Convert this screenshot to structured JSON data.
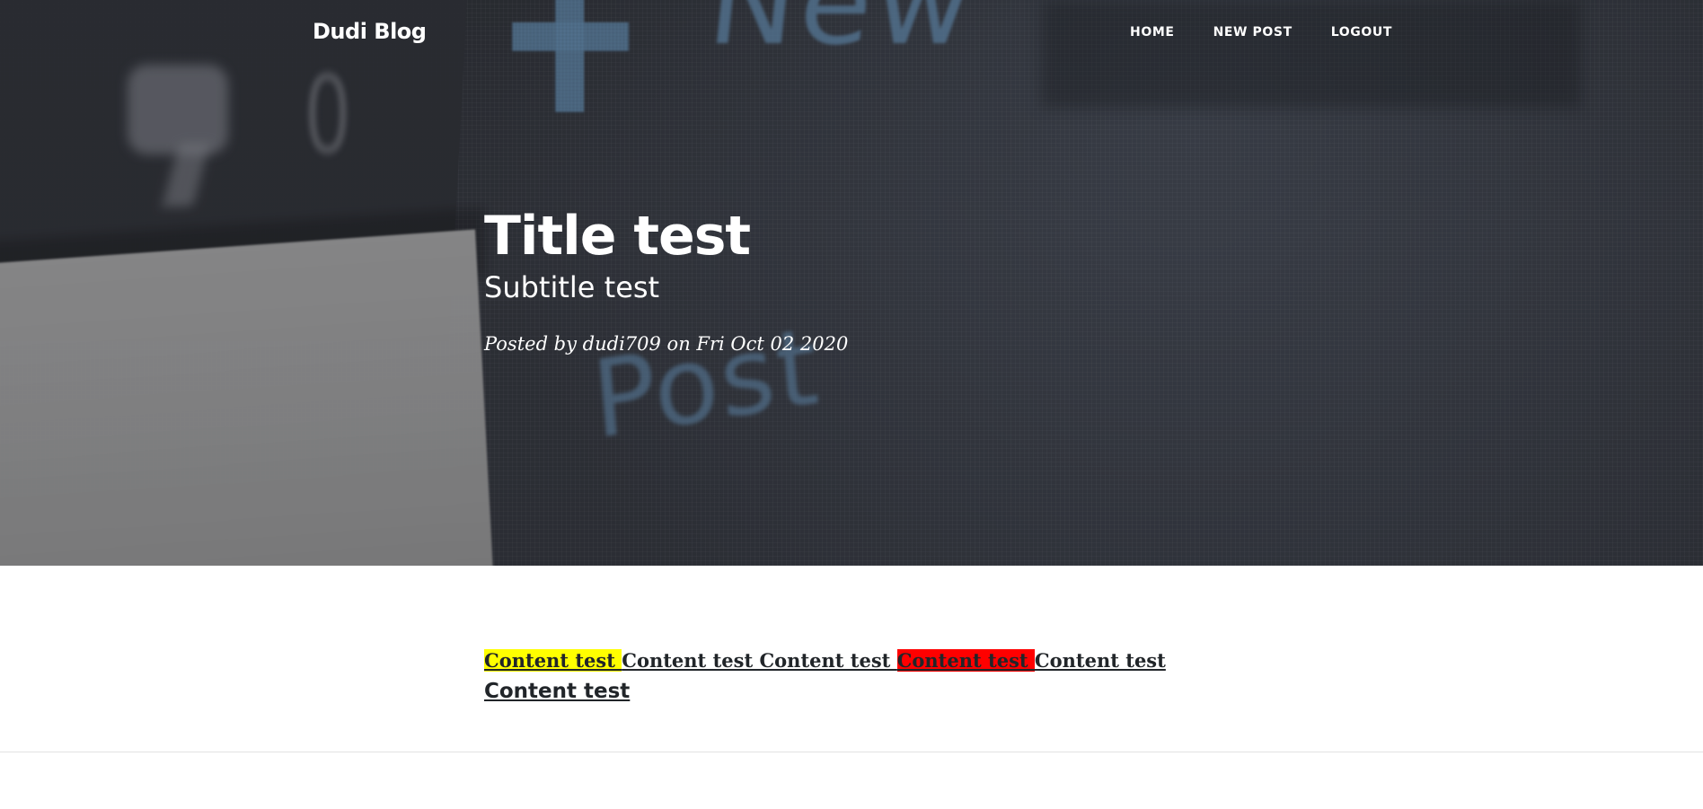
{
  "navbar": {
    "brand": "Dudi Blog",
    "links": [
      {
        "label": "HOME"
      },
      {
        "label": "NEW POST"
      },
      {
        "label": "LOGOUT"
      }
    ]
  },
  "header": {
    "background_glyphs": {
      "zero": "0",
      "new": "New",
      "post": "Post"
    },
    "title": "Title test",
    "subtitle": "Subtitle test",
    "meta": "Posted by dudi709 on Fri Oct 02 2020"
  },
  "content": {
    "segments": [
      {
        "text": "Content test ",
        "highlight": "#ffff00"
      },
      {
        "text": "Content test Content test "
      },
      {
        "text": "Content test ",
        "highlight": "#ff0000"
      },
      {
        "text": "Content test "
      },
      {
        "text": "Content test",
        "style": "sans-large"
      }
    ]
  },
  "colors": {
    "text": "#212529",
    "highlight_yellow": "#ffff00",
    "highlight_red": "#ff0000",
    "hero_bg": "#2d3037"
  }
}
